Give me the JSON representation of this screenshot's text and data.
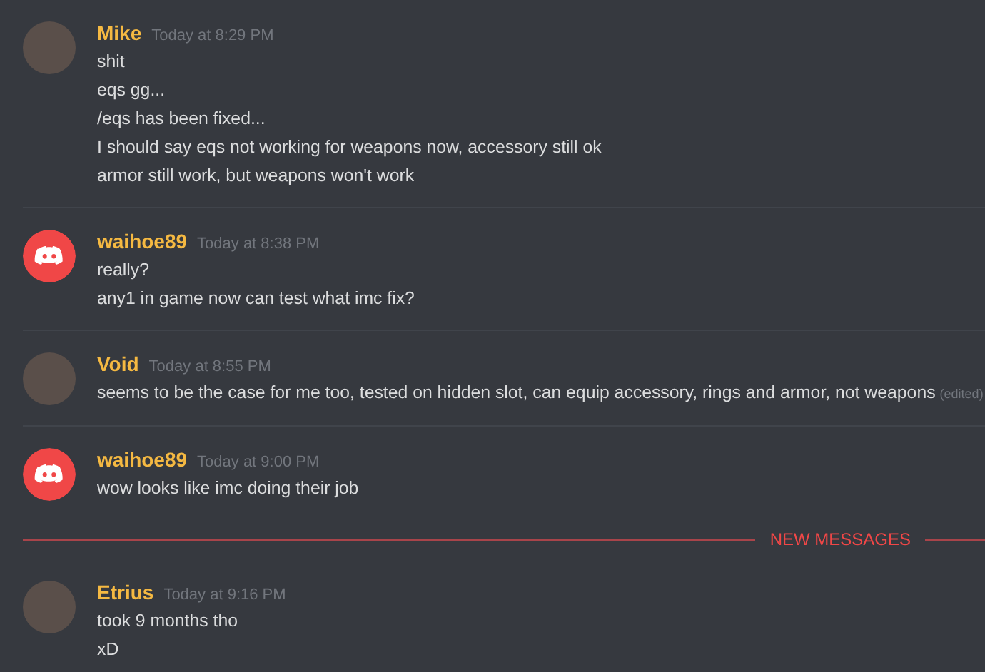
{
  "feed": [
    {
      "kind": "message",
      "author": "Mike",
      "avatar": {
        "kind": "photo"
      },
      "timestamp": "Today at 8:29 PM",
      "lines": [
        {
          "text": "shit"
        },
        {
          "text": "eqs gg..."
        },
        {
          "text": "/eqs has been fixed..."
        },
        {
          "text": "I should say eqs not working for weapons now, accessory still ok"
        },
        {
          "text": "armor still work, but weapons won't work"
        }
      ]
    },
    {
      "kind": "message",
      "author": "waihoe89",
      "avatar": {
        "kind": "discord"
      },
      "timestamp": "Today at 8:38 PM",
      "lines": [
        {
          "text": "really?"
        },
        {
          "text": "any1 in game now can test what imc fix?"
        }
      ]
    },
    {
      "kind": "message",
      "author": "Void",
      "avatar": {
        "kind": "photo"
      },
      "timestamp": "Today at 8:55 PM",
      "lines": [
        {
          "text": "seems to be the case for me too, tested on hidden slot, can equip accessory, rings and armor, not weapons",
          "edited": "(edited)"
        }
      ]
    },
    {
      "kind": "message",
      "author": "waihoe89",
      "avatar": {
        "kind": "discord"
      },
      "timestamp": "Today at 9:00 PM",
      "lines": [
        {
          "text": "wow looks like imc doing their job"
        }
      ]
    },
    {
      "kind": "new_messages",
      "label": "NEW MESSAGES"
    },
    {
      "kind": "message",
      "author": "Etrius",
      "avatar": {
        "kind": "photo"
      },
      "timestamp": "Today at 9:16 PM",
      "lines": [
        {
          "text": "took 9 months tho"
        },
        {
          "text": "xD"
        }
      ]
    }
  ]
}
